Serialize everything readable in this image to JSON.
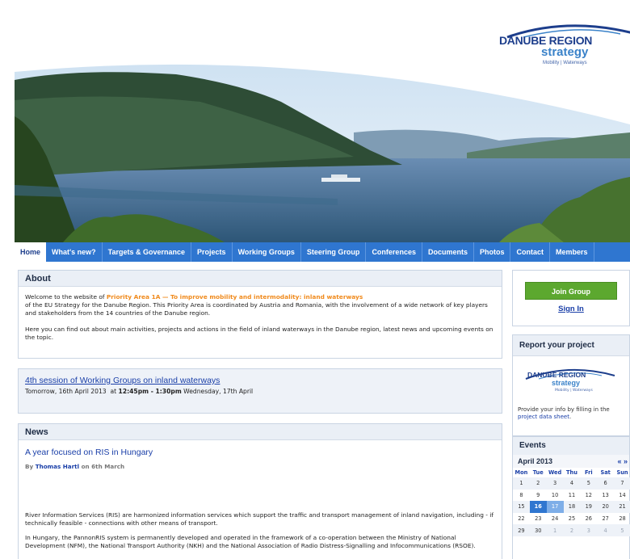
{
  "logo": {
    "line1": "DANUBE REGION",
    "line2": "strategy",
    "line3": "Mobility | Waterways"
  },
  "nav": {
    "tabs": [
      "Home",
      "What's new?",
      "Targets & Governance",
      "Projects",
      "Working Groups",
      "Steering Group",
      "Conferences",
      "Documents",
      "Photos",
      "Contact",
      "Members"
    ],
    "active_index": 0
  },
  "about": {
    "heading": "About",
    "intro_before": "Welcome to the website of ",
    "priority_area": "Priority Area 1A — To improve mobility and intermodality: inland waterways",
    "intro_after": "of the EU Strategy for the Danube Region. This Priority Area is coordinated by Austria and Romania, with the involvement of a wide network of key players and stakeholders from the 14 countries of the Danube region.",
    "para2": "Here you can find out about main activities, projects and actions in the field of inland waterways in the Danube region, latest news and upcoming events on the topic."
  },
  "upcoming_event": {
    "title": "4th session of Working Groups on inland waterways",
    "date_start": "Tomorrow, 16th April 2013",
    "at": "at",
    "time": "12:45pm - 1:30pm",
    "date_end": "Wednesday, 17th April"
  },
  "news": {
    "heading": "News",
    "article_title": "A year focused on RIS in Hungary",
    "by_label": "By",
    "author": "Thomas Hartl",
    "on_date": "on 6th March",
    "para1": "River Information Services (RIS) are harmonized information services which support the traffic and transport management of inland navigation, including - if technically feasible - connections with other means of transport.",
    "para2": "In Hungary, the PannonRIS system is permanently developed and operated in the framework of a co-operation between the Ministry of National Development (NFM), the National Transport Authority (NKH) and the National Association of Radio Distress-Signalling and Infocommunications (RSOE)."
  },
  "sidebar": {
    "join_label": "Join Group",
    "signin_label": "Sign In",
    "report_heading": "Report your project",
    "report_text_before": "Provide your info by filling in the ",
    "report_link": "project data sheet",
    "report_text_after": ".",
    "events_heading": "Events",
    "month": "April 2013",
    "prev": "«",
    "next": "»",
    "weekdays": [
      "Mon",
      "Tue",
      "Wed",
      "Thu",
      "Fri",
      "Sat",
      "Sun"
    ],
    "weeks": [
      [
        "1",
        "2",
        "3",
        "4",
        "5",
        "6",
        "7"
      ],
      [
        "8",
        "9",
        "10",
        "11",
        "12",
        "13",
        "14"
      ],
      [
        "15",
        "16",
        "17",
        "18",
        "19",
        "20",
        "21"
      ],
      [
        "22",
        "23",
        "24",
        "25",
        "26",
        "27",
        "28"
      ],
      [
        "29",
        "30",
        "1",
        "2",
        "3",
        "4",
        "5"
      ]
    ],
    "event_days": [
      "16",
      "17"
    ]
  },
  "colors": {
    "nav_blue": "#2f76d0",
    "accent_orange": "#f08a1c",
    "join_green": "#5ca82f",
    "link_blue": "#1a3fa8"
  }
}
